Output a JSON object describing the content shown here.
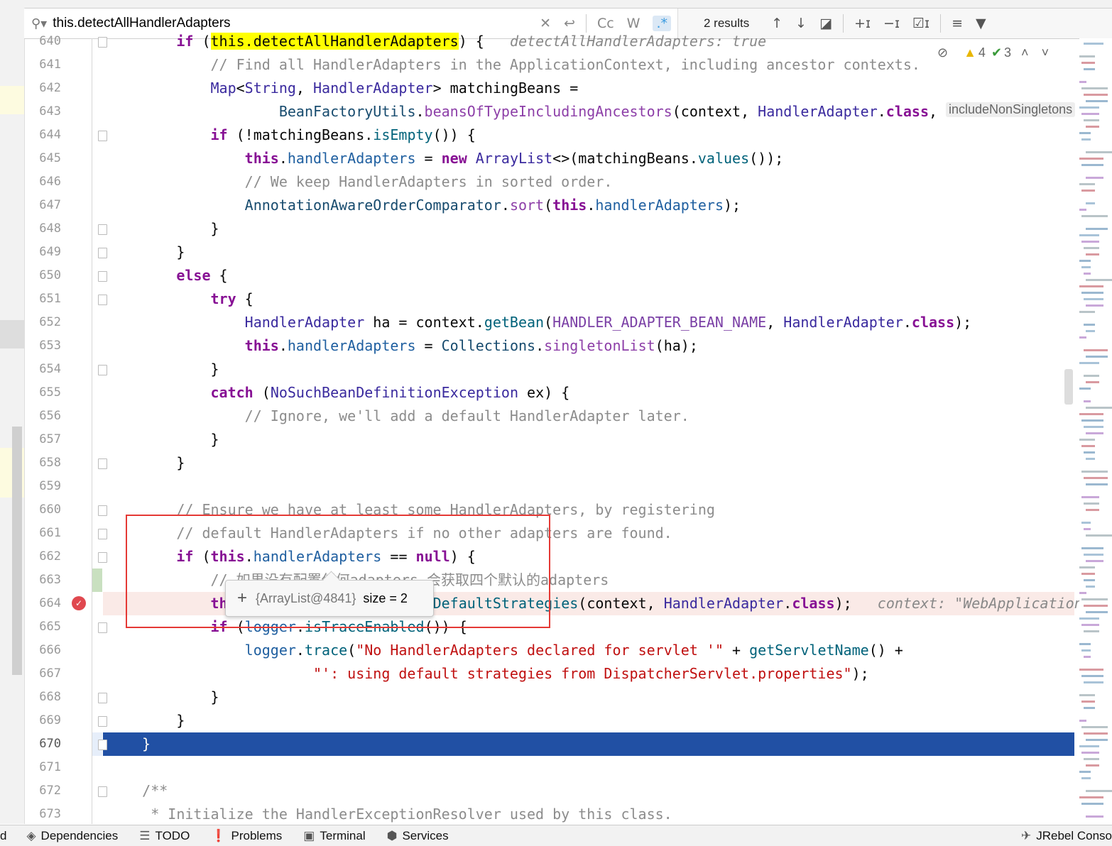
{
  "search": {
    "query": "this.detectAllHandlerAdapters",
    "results": "2 results"
  },
  "inspections": {
    "warnings": "4",
    "weak_warnings": "3"
  },
  "gutter": {
    "lines": [
      "640",
      "641",
      "642",
      "643",
      "644",
      "645",
      "646",
      "647",
      "648",
      "649",
      "650",
      "651",
      "652",
      "653",
      "654",
      "655",
      "656",
      "657",
      "658",
      "659",
      "660",
      "661",
      "662",
      "663",
      "664",
      "665",
      "666",
      "667",
      "668",
      "669",
      "670",
      "671",
      "672",
      "673"
    ]
  },
  "code": [
    [
      [
        "        ",
        ""
      ],
      [
        "if",
        "k"
      ],
      [
        " (",
        ""
      ],
      [
        "this.detectAllHandlerAdapters",
        "hl"
      ],
      [
        ") {   ",
        ""
      ],
      [
        "detectAllHandlerAdapters: true",
        "hint"
      ]
    ],
    [
      [
        "            // Find all HandlerAdapters in the ApplicationContext, including ancestor contexts.",
        "c"
      ]
    ],
    [
      [
        "            ",
        ""
      ],
      [
        "Map",
        "t"
      ],
      [
        "<",
        ""
      ],
      [
        "String",
        "t"
      ],
      [
        ", ",
        ""
      ],
      [
        "HandlerAdapter",
        "t"
      ],
      [
        "> matchingBeans =",
        ""
      ]
    ],
    [
      [
        "                    ",
        ""
      ],
      [
        "BeanFactoryUtils",
        "cl"
      ],
      [
        ".",
        ""
      ],
      [
        "beansOfTypeIncludingAncestors",
        "sm"
      ],
      [
        "(context, ",
        ""
      ],
      [
        "HandlerAdapter",
        "t"
      ],
      [
        ".",
        ""
      ],
      [
        "class",
        "k"
      ],
      [
        ",",
        ""
      ]
    ],
    [
      [
        "            ",
        ""
      ],
      [
        "if",
        "k"
      ],
      [
        " (!matchingBeans.",
        ""
      ],
      [
        "isEmpty",
        "m"
      ],
      [
        "()) {",
        ""
      ]
    ],
    [
      [
        "                ",
        ""
      ],
      [
        "this",
        "k"
      ],
      [
        ".",
        ""
      ],
      [
        "handlerAdapters",
        "f"
      ],
      [
        " = ",
        ""
      ],
      [
        "new",
        "k"
      ],
      [
        " ",
        ""
      ],
      [
        "ArrayList",
        "t"
      ],
      [
        "<>(matchingBeans.",
        ""
      ],
      [
        "values",
        "m"
      ],
      [
        "());",
        ""
      ]
    ],
    [
      [
        "                // We keep HandlerAdapters in sorted order.",
        "c"
      ]
    ],
    [
      [
        "                ",
        ""
      ],
      [
        "AnnotationAwareOrderComparator",
        "cl"
      ],
      [
        ".",
        ""
      ],
      [
        "sort",
        "sm"
      ],
      [
        "(",
        ""
      ],
      [
        "this",
        "k"
      ],
      [
        ".",
        ""
      ],
      [
        "handlerAdapters",
        "f"
      ],
      [
        ");",
        ""
      ]
    ],
    [
      [
        "            }",
        ""
      ]
    ],
    [
      [
        "        }",
        ""
      ]
    ],
    [
      [
        "        ",
        ""
      ],
      [
        "else",
        "k"
      ],
      [
        " {",
        ""
      ]
    ],
    [
      [
        "            ",
        ""
      ],
      [
        "try",
        "k"
      ],
      [
        " {",
        ""
      ]
    ],
    [
      [
        "                ",
        ""
      ],
      [
        "HandlerAdapter",
        "t"
      ],
      [
        " ha = context.",
        ""
      ],
      [
        "getBean",
        "m"
      ],
      [
        "(",
        ""
      ],
      [
        "HANDLER_ADAPTER_BEAN_NAME",
        "n"
      ],
      [
        ", ",
        ""
      ],
      [
        "HandlerAdapter",
        "t"
      ],
      [
        ".",
        ""
      ],
      [
        "class",
        "k"
      ],
      [
        ");",
        ""
      ]
    ],
    [
      [
        "                ",
        ""
      ],
      [
        "this",
        "k"
      ],
      [
        ".",
        ""
      ],
      [
        "handlerAdapters",
        "f"
      ],
      [
        " = ",
        ""
      ],
      [
        "Collections",
        "cl"
      ],
      [
        ".",
        ""
      ],
      [
        "singletonList",
        "sm"
      ],
      [
        "(ha);",
        ""
      ]
    ],
    [
      [
        "            }",
        ""
      ]
    ],
    [
      [
        "            ",
        ""
      ],
      [
        "catch",
        "k"
      ],
      [
        " (",
        ""
      ],
      [
        "NoSuchBeanDefinitionException",
        "t"
      ],
      [
        " ex) {",
        ""
      ]
    ],
    [
      [
        "                // Ignore, we'll add a default HandlerAdapter later.",
        "c"
      ]
    ],
    [
      [
        "            }",
        ""
      ]
    ],
    [
      [
        "        }",
        ""
      ]
    ],
    [
      [
        "",
        ""
      ]
    ],
    [
      [
        "        // Ensure we have at least some HandlerAdapters, by registering",
        "c"
      ]
    ],
    [
      [
        "        // default HandlerAdapters if no other adapters are found.",
        "c"
      ]
    ],
    [
      [
        "        ",
        ""
      ],
      [
        "if",
        "k"
      ],
      [
        " (",
        ""
      ],
      [
        "this",
        "k"
      ],
      [
        ".",
        ""
      ],
      [
        "handlerAdapters",
        "f"
      ],
      [
        " == ",
        ""
      ],
      [
        "null",
        "k"
      ],
      [
        ") {",
        ""
      ]
    ],
    [
      [
        "            // 如果没有配置任何adapters 会获取四个默认的adapters",
        "c"
      ]
    ],
    [
      [
        "            ",
        ""
      ],
      [
        "this",
        "k"
      ],
      [
        ".",
        ""
      ],
      [
        "handlerAdapters",
        "f"
      ],
      [
        " = ",
        ""
      ],
      [
        "getDefaultStrategies",
        "m"
      ],
      [
        "(context, ",
        ""
      ],
      [
        "HandlerAdapter",
        "t"
      ],
      [
        ".",
        ""
      ],
      [
        "class",
        "k"
      ],
      [
        ");   ",
        ""
      ],
      [
        "context: \"WebApplication",
        "hint"
      ]
    ],
    [
      [
        "            ",
        ""
      ],
      [
        "if",
        "k"
      ],
      [
        " (",
        ""
      ],
      [
        "logger",
        "f"
      ],
      [
        ".",
        ""
      ],
      [
        "isTraceEnabled",
        "m"
      ],
      [
        "()) {",
        ""
      ]
    ],
    [
      [
        "                ",
        ""
      ],
      [
        "logger",
        "f"
      ],
      [
        ".",
        ""
      ],
      [
        "trace",
        "m"
      ],
      [
        "(",
        ""
      ],
      [
        "\"No HandlerAdapters declared for servlet '\"",
        "s"
      ],
      [
        " + ",
        ""
      ],
      [
        "getServletName",
        "m"
      ],
      [
        "() +",
        ""
      ]
    ],
    [
      [
        "                        ",
        ""
      ],
      [
        "\"': using default strategies from DispatcherServlet.properties\"",
        "s"
      ],
      [
        ");",
        ""
      ]
    ],
    [
      [
        "            }",
        ""
      ]
    ],
    [
      [
        "        }",
        ""
      ]
    ],
    [
      [
        "    }",
        ""
      ]
    ],
    [
      [
        "",
        ""
      ]
    ],
    [
      [
        "    /**",
        "c"
      ]
    ],
    [
      [
        "     * Initialize the HandlerExceptionResolver used by this class.",
        "c"
      ]
    ]
  ],
  "inlay_hint": "includeNonSingletons",
  "debug_tooltip": {
    "expand": "+",
    "object": "{ArrayList@4841}",
    "size": "size = 2"
  },
  "statusbar": {
    "items": [
      "d",
      "Dependencies",
      "TODO",
      "Problems",
      "Terminal",
      "Services"
    ],
    "right": "JRebel Conso"
  },
  "colors": {
    "selection": "#2150a4",
    "breakpoint_line": "#faeae7",
    "search_highlight": "#ffff00",
    "annotation_box": "#e53935"
  }
}
